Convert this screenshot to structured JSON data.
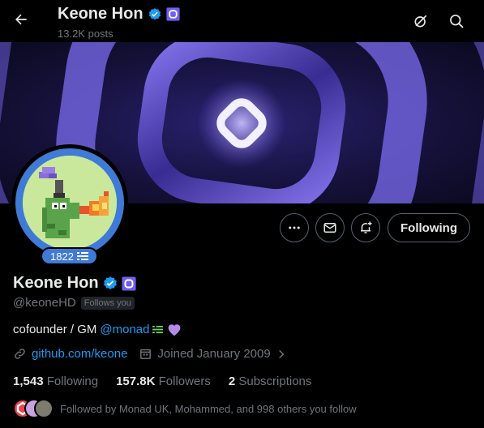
{
  "header": {
    "name": "Keone Hon",
    "posts": "13.2K posts"
  },
  "profile": {
    "name": "Keone Hon",
    "handle": "@keoneHD",
    "follows_you": "Follows you",
    "avatar_badge": "1822",
    "bio_text": "cofounder / GM",
    "bio_mention": "@monad",
    "website": "github.com/keone",
    "joined": "Joined January 2009",
    "following_count": "1,543",
    "following_label": "Following",
    "followers_count": "157.8K",
    "followers_label": "Followers",
    "subscriptions_count": "2",
    "subscriptions_label": "Subscriptions",
    "followed_by": "Followed by Monad UK, Mohammed, and 998 others you follow"
  },
  "actions": {
    "following_button": "Following"
  },
  "icons": [
    "back-arrow-icon",
    "verified-icon",
    "affiliate-badge-icon",
    "grok-icon",
    "search-icon",
    "more-icon",
    "message-icon",
    "notify-icon",
    "link-icon",
    "calendar-icon",
    "chevron-right-icon",
    "purple-heart-icon"
  ],
  "colors": {
    "accent": "#1d9bf0",
    "verified": "#1d9bf0",
    "avatar_ring": "#3f7ad6",
    "banner_purple": "#7a6cf0"
  }
}
